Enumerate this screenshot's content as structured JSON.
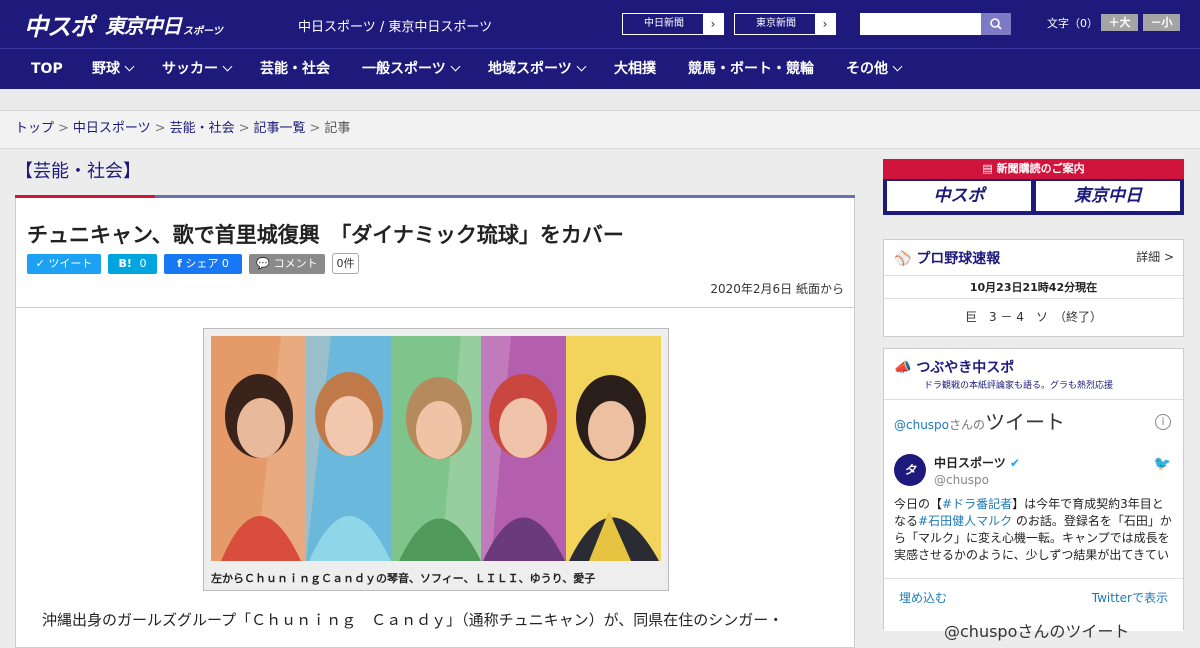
{
  "header": {
    "logo_main": "中スポ",
    "logo_sub": "東京中日",
    "logo_sub_small": "スポーツ",
    "site_title": "中日スポーツ / 東京中日スポーツ",
    "newspaper_buttons": [
      "中日新聞",
      "東京新聞"
    ],
    "search_placeholder": "",
    "font_size_label": "文字（0）",
    "font_bigger": "＋大",
    "font_smaller": "－小"
  },
  "nav": {
    "items": [
      {
        "label": "TOP",
        "dropdown": false
      },
      {
        "label": "野球",
        "dropdown": true
      },
      {
        "label": "サッカー",
        "dropdown": true
      },
      {
        "label": "芸能・社会",
        "dropdown": false
      },
      {
        "label": "一般スポーツ",
        "dropdown": true
      },
      {
        "label": "地域スポーツ",
        "dropdown": true
      },
      {
        "label": "大相撲",
        "dropdown": false
      },
      {
        "label": "競馬・ボート・競輪",
        "dropdown": false
      },
      {
        "label": "その他",
        "dropdown": true
      }
    ]
  },
  "breadcrumb": {
    "items": [
      "トップ",
      "中日スポーツ",
      "芸能・社会",
      "記事一覧"
    ],
    "current": "記事",
    "separator": ">"
  },
  "article": {
    "category": "【芸能・社会】",
    "headline": "チュニキャン、歌で首里城復興　「ダイナミック琉球」をカバー",
    "share": {
      "tweet": "ツイート",
      "hatena": "B!",
      "hatena_count": "0",
      "facebook": "シェア",
      "facebook_count": "0",
      "comment": "コメント",
      "comment_count": "0件"
    },
    "date": "2020年2月6日 紙面から",
    "caption": "左からＣｈｕｎｉｎｇＣａｎｄｙの琴音、ソフィー、ＬＩＬＩ、ゆうり、愛子",
    "body_first_line": "沖縄出身のガールズグループ「Ｃｈｕｎｉｎｇ　Ｃａｎｄｙ」（通称チュニキャン）が、同県在住のシンガー・"
  },
  "sidebar": {
    "ad": {
      "top": "新聞購読のご案内",
      "left": "中スポ",
      "right": "東京中日"
    },
    "baseball": {
      "title": "プロ野球速報",
      "detail": "詳細 >",
      "time": "10月23日21時42分現在",
      "score": "巨　3 － 4　ソ　（終了）"
    },
    "tweets": {
      "title": "つぶやき中スポ",
      "subtitle": "ドラ観戦の本紙評論家も語る。グラも熱烈応援",
      "panel_handle": "@chuspo",
      "panel_san": "さんの",
      "panel_word": "ツイート",
      "account_name": "中日スポーツ",
      "account_handle": "@chuspo",
      "tweet_text": [
        {
          "t": "今日の【",
          "hl": false
        },
        {
          "t": "#ドラ番記者",
          "hl": true
        },
        {
          "t": "】は今年で育成契約3年目となる",
          "hl": false
        },
        {
          "t": "#石田健人マルク",
          "hl": true
        },
        {
          "t": " のお話。登録名を「石田」から「マルク」に変え心機一転。キャンプでは成長を実感させるかのように、少しずつ結果が出てきている",
          "hl": false
        }
      ],
      "embed": "埋め込む",
      "view_on_twitter": "Twitterで表示",
      "next_title": "@chuspoさんのツイート"
    }
  },
  "colors": {
    "brand_navy": "#1d1a7c",
    "accent_red": "#d0143c",
    "twitter_blue": "#1da1f2",
    "facebook_blue": "#1877f2",
    "hatena_blue": "#00a4de"
  }
}
